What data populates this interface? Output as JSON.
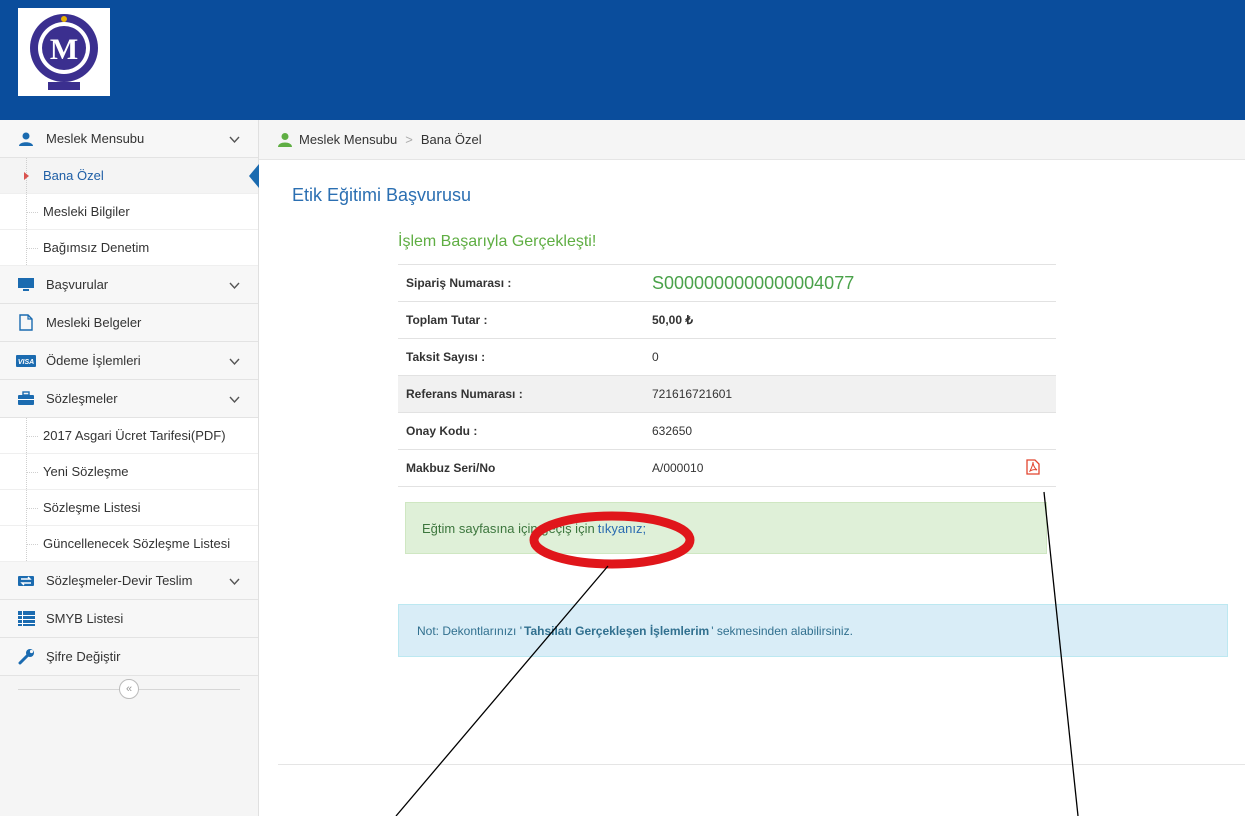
{
  "sidebar": {
    "groups": [
      {
        "label": "Meslek Mensubu",
        "icon": "user-icon",
        "has_chevron": true
      },
      {
        "label": "Başvurular",
        "icon": "monitor-icon",
        "has_chevron": true
      },
      {
        "label": "Mesleki Belgeler",
        "icon": "document-icon",
        "has_chevron": false
      },
      {
        "label": "Ödeme İşlemleri",
        "icon": "visa-card-icon",
        "has_chevron": true
      },
      {
        "label": "Sözleşmeler",
        "icon": "briefcase-icon",
        "has_chevron": true
      },
      {
        "label": "Sözleşmeler-Devir Teslim",
        "icon": "exchange-icon",
        "has_chevron": true
      },
      {
        "label": "SMYB Listesi",
        "icon": "list-icon",
        "has_chevron": false
      },
      {
        "label": "Şifre Değiştir",
        "icon": "wrench-icon",
        "has_chevron": false
      }
    ],
    "meslek_sub": [
      "Bana Özel",
      "Mesleki Bilgiler",
      "Bağımsız Denetim"
    ],
    "sozlesme_sub": [
      "2017 Asgari Ücret Tarifesi(PDF)",
      "Yeni Sözleşme",
      "Sözleşme Listesi",
      "Güncellenecek Sözleşme Listesi"
    ],
    "active_item": "Bana Özel",
    "collapse_icon": "«"
  },
  "breadcrumb": {
    "root": "Meslek Mensubu",
    "current": "Bana Özel"
  },
  "page": {
    "title": "Etik Eğitimi Başvurusu",
    "success_title": "İşlem Başarıyla Gerçekleşti!"
  },
  "details": {
    "rows": [
      {
        "label": "Sipariş Numarası :",
        "value": "S0000000000000004077"
      },
      {
        "label": "Toplam Tutar :",
        "value": "50,00 ₺"
      },
      {
        "label": "Taksit Sayısı :",
        "value": "0"
      },
      {
        "label": "Referans Numarası :",
        "value": "721616721601"
      },
      {
        "label": "Onay Kodu :",
        "value": "632650"
      },
      {
        "label": "Makbuz Seri/No",
        "value": "A/000010"
      }
    ],
    "pdf_icon": "pdf-icon"
  },
  "alert_success": {
    "text": "Eğtim sayfasına için geçiş için",
    "link": "tıkyanız;"
  },
  "alert_info": {
    "prefix": "Not: Dekontlarınızı '",
    "bold": "Tahsilatı Gerçekleşen İşlemlerim",
    "suffix": "' sekmesinden alabilirsiniz."
  },
  "colors": {
    "topbar": "#0a4d9c",
    "accent_blue": "#2b6fb2",
    "success_green": "#5fae43",
    "annotation_red": "#e0161b"
  }
}
